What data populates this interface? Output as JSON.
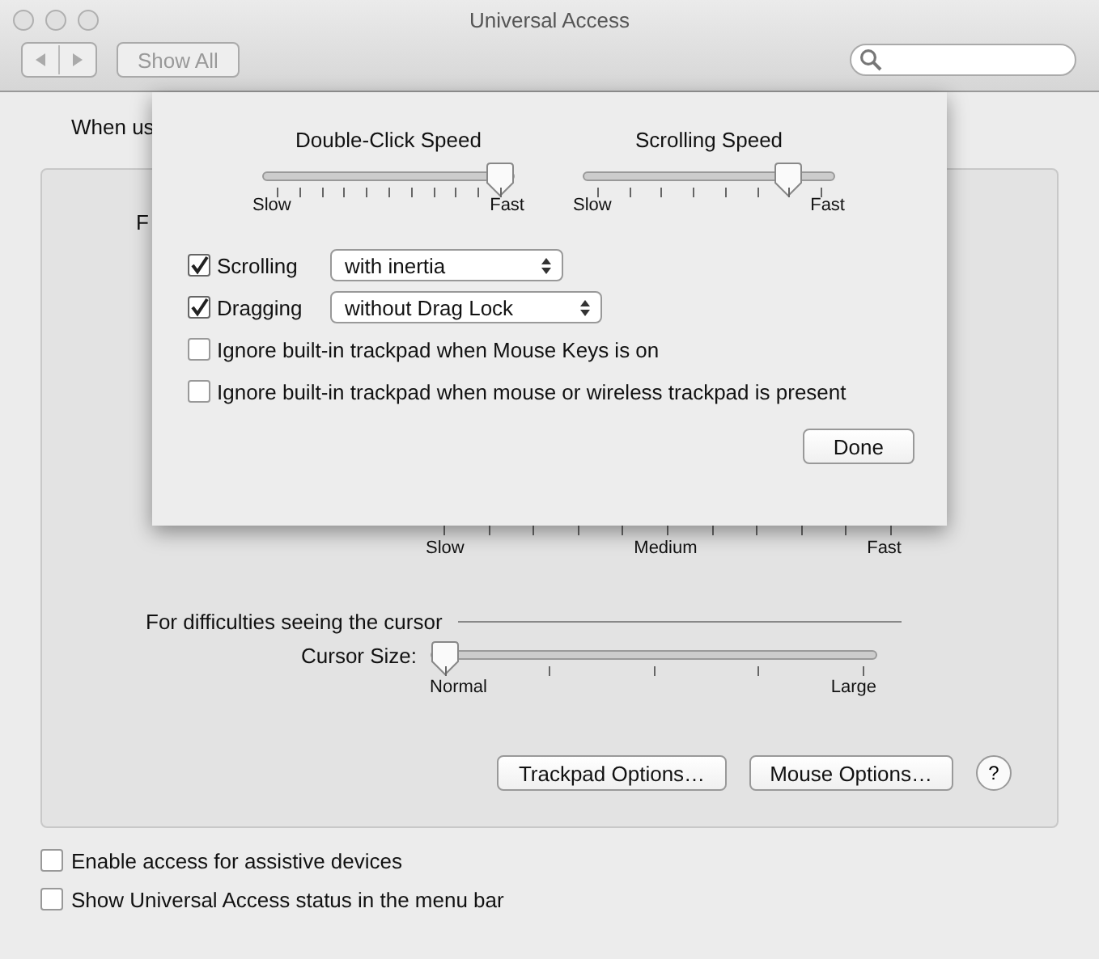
{
  "window": {
    "title": "Universal Access"
  },
  "toolbar": {
    "show_all": "Show All"
  },
  "background": {
    "prompt_fragment": "When us",
    "section_fragment": "F",
    "speed_labels": [
      "Slow",
      "Medium",
      "Fast"
    ],
    "cursor_section": "For difficulties seeing the cursor",
    "cursor_size": {
      "label": "Cursor Size:",
      "level": 0,
      "min": "Normal",
      "max": "Large"
    },
    "buttons": [
      "Trackpad Options…",
      "Mouse Options…"
    ],
    "help": "?"
  },
  "checkboxes": [
    {
      "label": "Enable access for assistive devices",
      "checked": false
    },
    {
      "label": "Show Universal Access status in the menu bar",
      "checked": false
    }
  ],
  "sheet": {
    "sliders": [
      {
        "title": "Double-Click Speed",
        "level": 1,
        "min": "Slow",
        "max": "Fast"
      },
      {
        "title": "Scrolling Speed",
        "level": 0.857,
        "min": "Slow",
        "max": "Fast"
      }
    ],
    "options": [
      {
        "kind": "popup",
        "label": "Scrolling",
        "checked": true,
        "value": "with inertia"
      },
      {
        "kind": "popup",
        "label": "Dragging",
        "checked": true,
        "value": "without Drag Lock"
      },
      {
        "kind": "plain",
        "label": "Ignore built-in trackpad when Mouse Keys is on",
        "checked": false
      },
      {
        "kind": "plain",
        "label": "Ignore built-in trackpad when mouse or wireless trackpad is present",
        "checked": false
      }
    ],
    "done": "Done"
  }
}
